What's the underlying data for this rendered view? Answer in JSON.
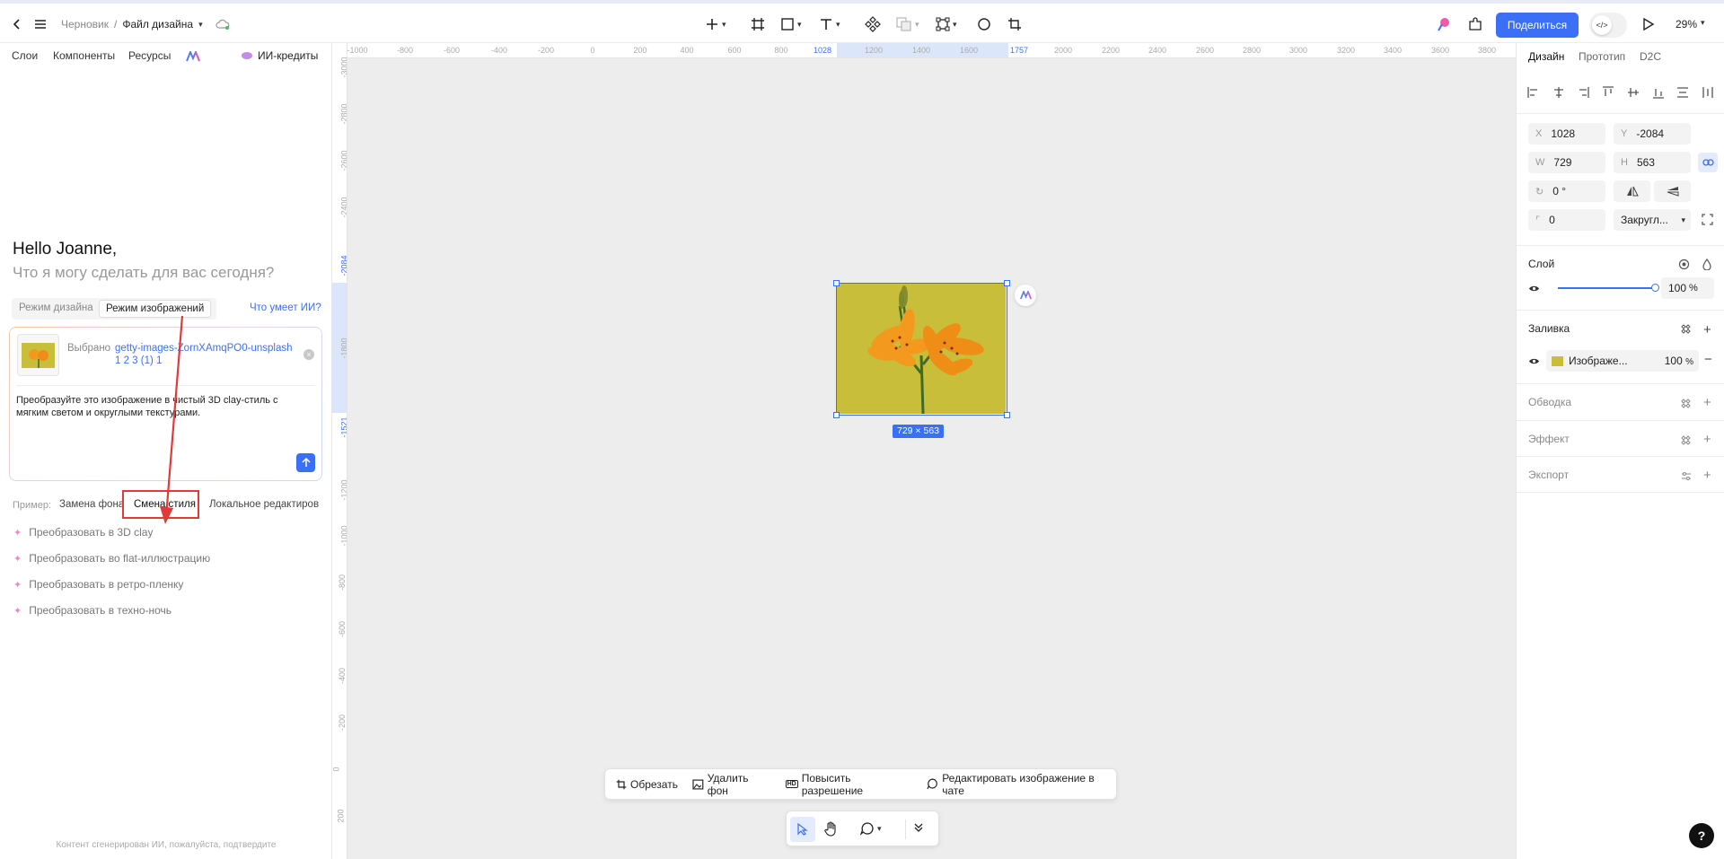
{
  "header": {
    "breadcrumb_root": "Черновик",
    "breadcrumb_sep": "/",
    "file_name": "Файл дизайна",
    "share_label": "Поделиться",
    "zoom": "29%"
  },
  "left": {
    "tabs": [
      "Слои",
      "Компоненты",
      "Ресурсы"
    ],
    "credits_label": "ИИ-кредиты",
    "greeting": "Hello Joanne,",
    "question": "Что я могу сделать для вас сегодня?",
    "mode_tabs": [
      "Режим дизайна",
      "Режим изображений"
    ],
    "what_ai_can": "Что умеет ИИ?",
    "selected_label": "Выбрано",
    "selected_name_line1": "getty-images-ZornXAmqPO0-unsplash",
    "selected_name_line2": "1 2 3 (1) 1",
    "prompt_text": "Преобразуйте это изображение в чистый 3D clay-стиль с мягким светом и округлыми текстурами.",
    "example_label": "Пример:",
    "example_tabs": [
      "Замена фона",
      "Смена стиля",
      "Локальное редактиров"
    ],
    "suggestions": [
      "Преобразовать в 3D clay",
      "Преобразовать во flat-иллюстрацию",
      "Преобразовать в ретро-пленку",
      "Преобразовать в техно-ночь"
    ],
    "footer": "Контент сгенерирован ИИ, пожалуйста, подтвердите"
  },
  "ruler": {
    "h_labels": [
      "-1000",
      "-800",
      "-600",
      "-400",
      "-200",
      "0",
      "200",
      "400",
      "600",
      "800",
      "1028",
      "1200",
      "1400",
      "1600",
      "1757",
      "2000",
      "2200",
      "2400",
      "2600",
      "2800",
      "3000",
      "3200",
      "3400",
      "3600",
      "3800"
    ],
    "v_labels": [
      "-3000",
      "-2800",
      "-2600",
      "-2400",
      "-2084",
      "-1800",
      "-1521",
      "-1200",
      "-1000",
      "-800",
      "-600",
      "-400",
      "-200",
      "0",
      "200"
    ]
  },
  "canvas": {
    "size_badge": "729 × 563"
  },
  "image_toolbar": {
    "crop": "Обрезать",
    "remove_bg": "Удалить фон",
    "upscale": "Повысить разрешение",
    "edit_in_chat": "Редактировать изображение в чате"
  },
  "right": {
    "tabs": [
      "Дизайн",
      "Прототип",
      "D2C"
    ],
    "x_label": "X",
    "x": "1028",
    "y_label": "Y",
    "y": "-2084",
    "w_label": "W",
    "w": "729",
    "h_label": "H",
    "h": "563",
    "rotation": "0 °",
    "radius": "0",
    "corner_type": "Закругл...",
    "layer_title": "Слой",
    "opacity": "100",
    "opacity_unit": "%",
    "fill_title": "Заливка",
    "fill_name": "Изображе...",
    "fill_opacity": "100",
    "fill_unit": "%",
    "stroke_title": "Обводка",
    "effect_title": "Эффект",
    "export_title": "Экспорт"
  },
  "colors": {
    "accent": "#3b6ff5",
    "highlight_red": "#e03a3a",
    "image_bg": "#c8be3a",
    "lily": "#f39a1e"
  }
}
